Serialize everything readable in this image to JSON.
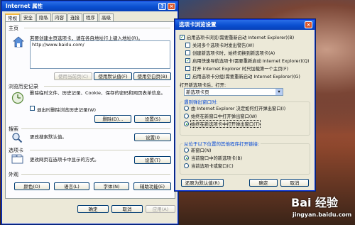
{
  "dialog1": {
    "title": "Internet 属性",
    "tabs": [
      "常规",
      "安全",
      "隐私",
      "内容",
      "连接",
      "程序",
      "高级"
    ],
    "homepage": {
      "section": "主页",
      "desc": "若要创建主页选项卡，请在各自地址行上键入地址(R)。",
      "url": "http://www.baidu.com/",
      "btn_current": "使用当前页(C)",
      "btn_default": "使用默认值(F)",
      "btn_blank": "使用空白页(B)"
    },
    "history": {
      "section": "浏览历史记录",
      "desc": "删除临时文件、历史记录、Cookie、保存的密码和网页表单信息。",
      "exit_delete": "退出时删除浏览历史记录(W)",
      "btn_delete": "删除(D)...",
      "btn_settings": "设置(S)"
    },
    "search": {
      "section": "搜索",
      "desc": "更改搜索默认值。",
      "btn_settings": "设置(I)"
    },
    "tabs_section": {
      "section": "选项卡",
      "desc": "更改网页在选项卡中显示的方式。",
      "btn_settings": "设置(T)"
    },
    "appearance": {
      "section": "外观",
      "btn_colors": "颜色(O)",
      "btn_languages": "语言(L)",
      "btn_fonts": "字体(N)",
      "btn_access": "辅助功能(E)"
    },
    "footer": {
      "ok": "确定",
      "cancel": "取消",
      "apply": "应用(A)"
    }
  },
  "dialog2": {
    "title": "选项卡浏览设置",
    "enable_tabs": "启用选项卡浏览(需要重新启动 Internet Explorer)(B)",
    "options": [
      {
        "label": "关闭多个选项卡时发出警告(W)",
        "checked": false
      },
      {
        "label": "创建新选项卡时，始终切换到新选项卡(A)",
        "checked": false
      },
      {
        "label": "启用快速导航选项卡(需要重新启动 Internet Explorer)(Q)",
        "checked": true
      },
      {
        "label": "打开 Internet Explorer 时只加载第一个主页(F)",
        "checked": false
      },
      {
        "label": "启用选项卡分组(需要重新启动 Internet Explorer)(G)",
        "checked": true
      }
    ],
    "newtab_label": "打开新选项卡后，打开:",
    "newtab_value": "新选项卡页",
    "popups": {
      "group": "遇到弹出窗口时:",
      "options": [
        {
          "label": "由 Internet Explorer 决定如何打开弹出窗口(I)",
          "selected": false
        },
        {
          "label": "始终在新窗口中打开弹出窗口(W)",
          "selected": false
        },
        {
          "label": "始终在新选项卡中打开弹出窗口(T)",
          "selected": true
        }
      ]
    },
    "links": {
      "group": "从位于以下位置的其他程序打开链接:",
      "options": [
        {
          "label": "新窗口(N)",
          "selected": false
        },
        {
          "label": "当前窗口中的新选项卡(B)",
          "selected": true
        },
        {
          "label": "当前选项卡或窗口(C)",
          "selected": false
        }
      ]
    },
    "btn_restore": "还原为默认值(R)",
    "btn_ok": "确定",
    "btn_cancel": "取消"
  },
  "watermark": {
    "logo": "Bai 经验",
    "url": "jingyan.baidu.com"
  }
}
